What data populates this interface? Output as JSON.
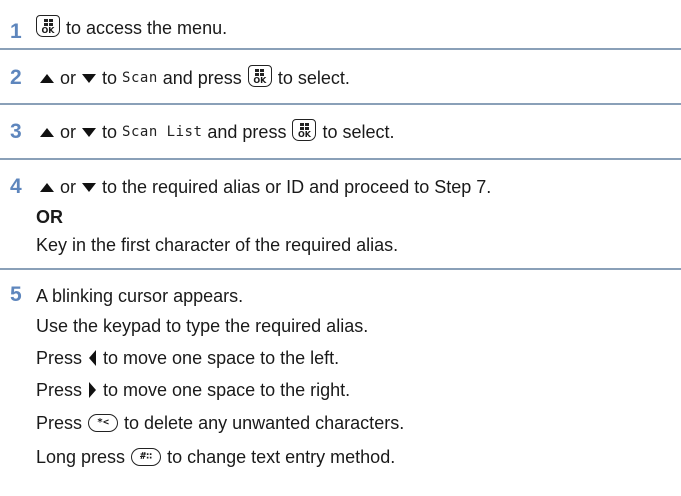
{
  "step1": {
    "number": "1",
    "text": "to access the menu.",
    "key": "OK"
  },
  "step2": {
    "number": "2",
    "or": "or",
    "to": "to",
    "menu_item": "Scan",
    "rest": "and press",
    "end": "to select.",
    "key": "OK"
  },
  "step3": {
    "number": "3",
    "or": "or",
    "to": "to",
    "menu_item": "Scan List",
    "rest": "and press",
    "end": "to select.",
    "key": "OK"
  },
  "step4": {
    "number": "4",
    "or": "or",
    "text": "to the required alias or ID and proceed to Step 7.",
    "or_label": "OR",
    "alt": "Key in the first character of the required alias."
  },
  "step5": {
    "number": "5",
    "line1": "A blinking cursor appears.",
    "line2": "Use the keypad to type the required alias.",
    "press": "Press",
    "left_text": "to move one space to the left.",
    "right_text": "to move one space to the right.",
    "delete_key": "*<",
    "delete_text": "to delete any unwanted characters.",
    "long_press": "Long press",
    "hash_key": "#∷",
    "hash_text": "to change text entry method."
  },
  "colors": {
    "step_number": "#5e86bd",
    "rule": "#8aa0b8"
  }
}
